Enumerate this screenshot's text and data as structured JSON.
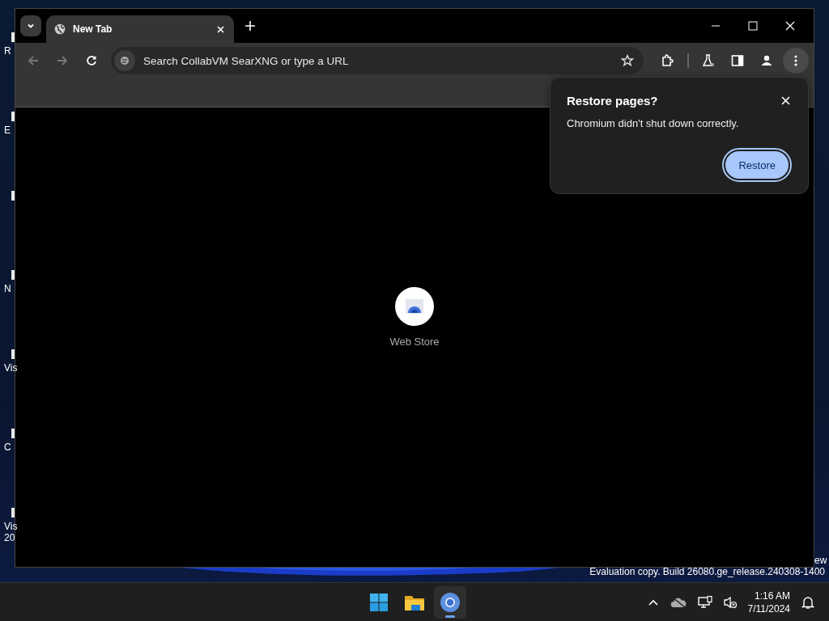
{
  "desktop": {
    "icons": [
      {
        "kind": "labeled",
        "text": "R"
      },
      {
        "kind": "labeled",
        "text": "E"
      },
      {
        "kind": "unlabeled"
      },
      {
        "kind": "labeled",
        "text": "N"
      },
      {
        "kind": "labeled",
        "text": "Vis"
      },
      {
        "kind": "labeled",
        "text": "C"
      },
      {
        "kind": "labeled",
        "text": "Vis\n20"
      }
    ],
    "right_label": "ew",
    "watermark": "Evaluation copy. Build 26080.ge_release.240308-1400"
  },
  "browser": {
    "tabs": [
      {
        "title": "New Tab",
        "selected": true
      }
    ],
    "address_bar": {
      "placeholder": "Search CollabVM SearXNG or type a URL"
    },
    "shortcuts": [
      {
        "label": "Web Store"
      }
    ],
    "dialog": {
      "title": "Restore pages?",
      "message": "Chromium didn't shut down correctly.",
      "button": "Restore"
    }
  },
  "taskbar": {
    "apps": [
      {
        "kind": "start",
        "selected": false
      },
      {
        "kind": "files",
        "selected": false
      },
      {
        "kind": "browser",
        "selected": true
      }
    ],
    "time": "1:16 AM",
    "date": "7/11/2024"
  }
}
